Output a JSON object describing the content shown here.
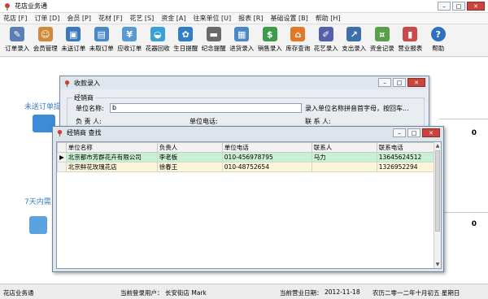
{
  "app": {
    "title": "花店业务通"
  },
  "menu": [
    "花店 [F]",
    "订单 [D]",
    "会员 [P]",
    "花材 [F]",
    "花艺 [S]",
    "资金 [A]",
    "往来单位 [U]",
    "报表 [R]",
    "基础设置 [B]",
    "帮助 [H]"
  ],
  "toolbar": [
    {
      "label": "订单录入",
      "icon": "order-entry-icon",
      "color": "#5a7fb5"
    },
    {
      "label": "会员管理",
      "icon": "members-icon",
      "color": "#d08a3a"
    },
    {
      "label": "未送订单",
      "icon": "undelivered-icon",
      "color": "#3b78c4"
    },
    {
      "label": "未取订单",
      "icon": "unpicked-icon",
      "color": "#4a89c9"
    },
    {
      "label": "应收订单",
      "icon": "receivable-icon",
      "color": "#5a9ad4"
    },
    {
      "label": "花器回收",
      "icon": "basket-icon",
      "color": "#3aa0d8"
    },
    {
      "label": "生日提醒",
      "icon": "birthday-icon",
      "color": "#2f7fc8"
    },
    {
      "label": "纪念提醒",
      "icon": "memorial-icon",
      "color": "#6a6a6a"
    },
    {
      "label": "进货录入",
      "icon": "purchase-icon",
      "color": "#4b88c8"
    },
    {
      "label": "销售录入",
      "icon": "sales-icon",
      "color": "#3c9a4a"
    },
    {
      "label": "库存查询",
      "icon": "warehouse-icon",
      "color": "#e07a2a"
    },
    {
      "label": "花艺录入",
      "icon": "floral-icon",
      "color": "#5560a8"
    },
    {
      "label": "支出录入",
      "icon": "expense-icon",
      "color": "#3f6fa8"
    },
    {
      "label": "资金记录",
      "icon": "money-icon",
      "color": "#58a04a"
    },
    {
      "label": "营业报表",
      "icon": "report-icon",
      "color": "#c84a4a"
    },
    {
      "label": "帮助",
      "icon": "help-icon",
      "color": "#2d6fc0"
    }
  ],
  "desktop": {
    "undelivered_label": "未送订单提",
    "seven_days_label": "7天内需",
    "count_top": "0",
    "count_bottom": "0"
  },
  "dialog_receipt": {
    "title": "收款录入",
    "group_label": "经销商",
    "unit_name_label": "单位名称:",
    "unit_name_value": "b",
    "unit_hint": "录入单位名称拼音首字母，按回车...",
    "person_label": "负 责 人:",
    "phone_label": "单位电话:",
    "contact_label": "联 系 人:"
  },
  "dialog_search": {
    "title": "经销商 查找",
    "columns": [
      "单位名称",
      "负责人",
      "单位电话",
      "联系人",
      "联系电话"
    ],
    "rows": [
      [
        "北京都市芳群花卉有限公司",
        "李老板",
        "010-456978795",
        "马力",
        "13645624512"
      ],
      [
        "北京鲜花玫瑰花店",
        "徐春王",
        "010-48752654",
        "",
        "1326952294"
      ]
    ]
  },
  "status": {
    "app_name": "花店业务通",
    "user_label": "当前登录用户：",
    "user_value": "长安街店  Mark",
    "date_label": "当前营业日期：",
    "date_value": "2012-11-18",
    "lunar_date": "农历二零一二年十月初五  星期日"
  },
  "colors": {
    "row_selected": "#c8f0d2",
    "row_alt": "#fbf6d8",
    "accent_link": "#3d7ec4"
  }
}
